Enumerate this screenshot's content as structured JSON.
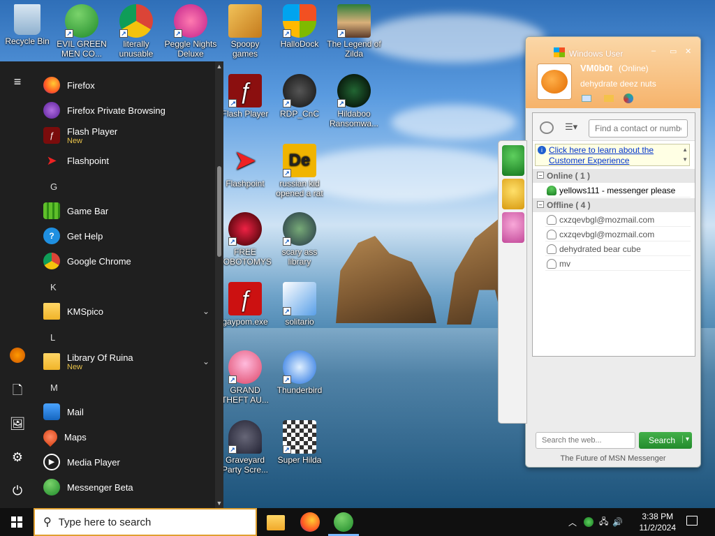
{
  "desktop": {
    "icons": [
      {
        "label": "Recycle Bin"
      },
      {
        "label": "EVIL GREEN MEN CO..."
      },
      {
        "label": "literally unusable"
      },
      {
        "label": "Peggle Nights Deluxe"
      },
      {
        "label": "Spoopy games"
      },
      {
        "label": "HalloDock"
      },
      {
        "label": "The Legend of Zilda"
      },
      {
        "label": "Flash Player"
      },
      {
        "label": "RDP_CnC"
      },
      {
        "label": "Hildaboo Ransomwa..."
      },
      {
        "label": "Flashpoint"
      },
      {
        "label": "russian kid opened a rat"
      },
      {
        "label": "FREE LOBOTOMYS"
      },
      {
        "label": "scary ass library"
      },
      {
        "label": "gaypom.exe"
      },
      {
        "label": "solitario"
      },
      {
        "label": "GRAND THEFT AU..."
      },
      {
        "label": "Thunderbird"
      },
      {
        "label": "Graveyard Party Scre..."
      },
      {
        "label": "Super Hilda"
      }
    ]
  },
  "start_menu": {
    "apps": [
      {
        "label": "Firefox"
      },
      {
        "label": "Firefox Private Browsing"
      },
      {
        "label": "Flash Player",
        "sub": "New"
      },
      {
        "label": "Flashpoint"
      },
      {
        "label": "Game Bar"
      },
      {
        "label": "Get Help"
      },
      {
        "label": "Google Chrome"
      },
      {
        "label": "KMSpico"
      },
      {
        "label": "Library Of Ruina",
        "sub": "New"
      },
      {
        "label": "Mail"
      },
      {
        "label": "Maps"
      },
      {
        "label": "Media Player"
      },
      {
        "label": "Messenger Beta"
      }
    ],
    "letters": [
      "G",
      "K",
      "L",
      "M"
    ]
  },
  "taskbar": {
    "search_placeholder": "Type here to search",
    "time": "3:38 PM",
    "date": "11/2/2024"
  },
  "messenger": {
    "title": "Windows User",
    "username": "VM0b0t",
    "status": "(Online)",
    "personal_message": "dehydrate deez nuts",
    "find_placeholder": "Find a contact or number",
    "banner_text": "Click here to learn about the Customer Experience",
    "online_header": "Online ( 1 )",
    "offline_header": "Offline ( 4 )",
    "online_contacts": [
      "yellows111 - messenger please"
    ],
    "offline_contacts": [
      "cxzqevbgl@mozmail.com",
      "cxzqevbgl@mozmail.com",
      "dehydrated bear cube",
      "mv"
    ],
    "web_search_placeholder": "Search the web...",
    "search_button": "Search",
    "footer": "The Future of MSN Messenger"
  },
  "colors": {
    "taskbar": "#101010",
    "start_menu": "#1f1f1f",
    "msn_orange": "#f6b36b",
    "msn_green": "#238b2c"
  }
}
